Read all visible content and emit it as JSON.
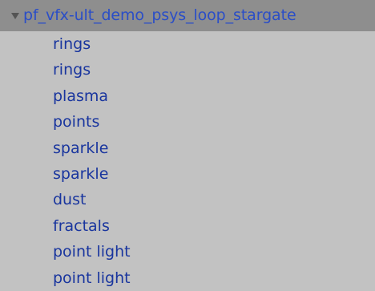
{
  "hierarchy": {
    "root": {
      "label": "pf_vfx-ult_demo_psys_loop_stargate",
      "expanded": true,
      "icon": "fold-arrow-down"
    },
    "children": [
      {
        "label": "rings"
      },
      {
        "label": "rings"
      },
      {
        "label": "plasma"
      },
      {
        "label": "points"
      },
      {
        "label": "sparkle"
      },
      {
        "label": "sparkle"
      },
      {
        "label": "dust"
      },
      {
        "label": "fractals"
      },
      {
        "label": "point light"
      },
      {
        "label": "point light"
      }
    ]
  },
  "colors": {
    "panel_background": "#c2c2c2",
    "selected_row_background": "#8e8e8e",
    "root_text": "#2b4ec7",
    "child_text": "#19359e",
    "arrow": "#545454"
  }
}
